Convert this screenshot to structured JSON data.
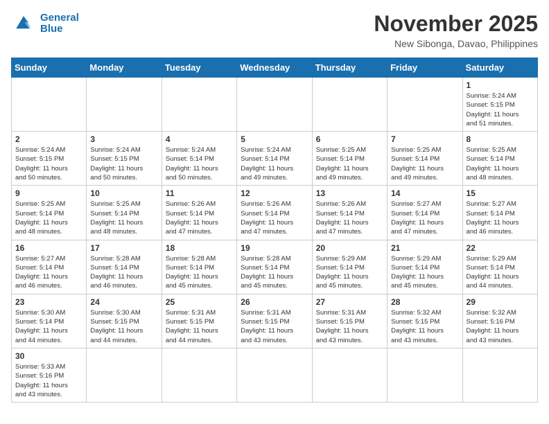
{
  "header": {
    "logo_line1": "General",
    "logo_line2": "Blue",
    "month": "November 2025",
    "location": "New Sibonga, Davao, Philippines"
  },
  "weekdays": [
    "Sunday",
    "Monday",
    "Tuesday",
    "Wednesday",
    "Thursday",
    "Friday",
    "Saturday"
  ],
  "weeks": [
    [
      {
        "day": "",
        "info": ""
      },
      {
        "day": "",
        "info": ""
      },
      {
        "day": "",
        "info": ""
      },
      {
        "day": "",
        "info": ""
      },
      {
        "day": "",
        "info": ""
      },
      {
        "day": "",
        "info": ""
      },
      {
        "day": "1",
        "info": "Sunrise: 5:24 AM\nSunset: 5:15 PM\nDaylight: 11 hours\nand 51 minutes."
      }
    ],
    [
      {
        "day": "2",
        "info": "Sunrise: 5:24 AM\nSunset: 5:15 PM\nDaylight: 11 hours\nand 50 minutes."
      },
      {
        "day": "3",
        "info": "Sunrise: 5:24 AM\nSunset: 5:15 PM\nDaylight: 11 hours\nand 50 minutes."
      },
      {
        "day": "4",
        "info": "Sunrise: 5:24 AM\nSunset: 5:14 PM\nDaylight: 11 hours\nand 50 minutes."
      },
      {
        "day": "5",
        "info": "Sunrise: 5:24 AM\nSunset: 5:14 PM\nDaylight: 11 hours\nand 49 minutes."
      },
      {
        "day": "6",
        "info": "Sunrise: 5:25 AM\nSunset: 5:14 PM\nDaylight: 11 hours\nand 49 minutes."
      },
      {
        "day": "7",
        "info": "Sunrise: 5:25 AM\nSunset: 5:14 PM\nDaylight: 11 hours\nand 49 minutes."
      },
      {
        "day": "8",
        "info": "Sunrise: 5:25 AM\nSunset: 5:14 PM\nDaylight: 11 hours\nand 48 minutes."
      }
    ],
    [
      {
        "day": "9",
        "info": "Sunrise: 5:25 AM\nSunset: 5:14 PM\nDaylight: 11 hours\nand 48 minutes."
      },
      {
        "day": "10",
        "info": "Sunrise: 5:25 AM\nSunset: 5:14 PM\nDaylight: 11 hours\nand 48 minutes."
      },
      {
        "day": "11",
        "info": "Sunrise: 5:26 AM\nSunset: 5:14 PM\nDaylight: 11 hours\nand 47 minutes."
      },
      {
        "day": "12",
        "info": "Sunrise: 5:26 AM\nSunset: 5:14 PM\nDaylight: 11 hours\nand 47 minutes."
      },
      {
        "day": "13",
        "info": "Sunrise: 5:26 AM\nSunset: 5:14 PM\nDaylight: 11 hours\nand 47 minutes."
      },
      {
        "day": "14",
        "info": "Sunrise: 5:27 AM\nSunset: 5:14 PM\nDaylight: 11 hours\nand 47 minutes."
      },
      {
        "day": "15",
        "info": "Sunrise: 5:27 AM\nSunset: 5:14 PM\nDaylight: 11 hours\nand 46 minutes."
      }
    ],
    [
      {
        "day": "16",
        "info": "Sunrise: 5:27 AM\nSunset: 5:14 PM\nDaylight: 11 hours\nand 46 minutes."
      },
      {
        "day": "17",
        "info": "Sunrise: 5:28 AM\nSunset: 5:14 PM\nDaylight: 11 hours\nand 46 minutes."
      },
      {
        "day": "18",
        "info": "Sunrise: 5:28 AM\nSunset: 5:14 PM\nDaylight: 11 hours\nand 45 minutes."
      },
      {
        "day": "19",
        "info": "Sunrise: 5:28 AM\nSunset: 5:14 PM\nDaylight: 11 hours\nand 45 minutes."
      },
      {
        "day": "20",
        "info": "Sunrise: 5:29 AM\nSunset: 5:14 PM\nDaylight: 11 hours\nand 45 minutes."
      },
      {
        "day": "21",
        "info": "Sunrise: 5:29 AM\nSunset: 5:14 PM\nDaylight: 11 hours\nand 45 minutes."
      },
      {
        "day": "22",
        "info": "Sunrise: 5:29 AM\nSunset: 5:14 PM\nDaylight: 11 hours\nand 44 minutes."
      }
    ],
    [
      {
        "day": "23",
        "info": "Sunrise: 5:30 AM\nSunset: 5:14 PM\nDaylight: 11 hours\nand 44 minutes."
      },
      {
        "day": "24",
        "info": "Sunrise: 5:30 AM\nSunset: 5:15 PM\nDaylight: 11 hours\nand 44 minutes."
      },
      {
        "day": "25",
        "info": "Sunrise: 5:31 AM\nSunset: 5:15 PM\nDaylight: 11 hours\nand 44 minutes."
      },
      {
        "day": "26",
        "info": "Sunrise: 5:31 AM\nSunset: 5:15 PM\nDaylight: 11 hours\nand 43 minutes."
      },
      {
        "day": "27",
        "info": "Sunrise: 5:31 AM\nSunset: 5:15 PM\nDaylight: 11 hours\nand 43 minutes."
      },
      {
        "day": "28",
        "info": "Sunrise: 5:32 AM\nSunset: 5:15 PM\nDaylight: 11 hours\nand 43 minutes."
      },
      {
        "day": "29",
        "info": "Sunrise: 5:32 AM\nSunset: 5:16 PM\nDaylight: 11 hours\nand 43 minutes."
      }
    ],
    [
      {
        "day": "30",
        "info": "Sunrise: 5:33 AM\nSunset: 5:16 PM\nDaylight: 11 hours\nand 43 minutes."
      },
      {
        "day": "",
        "info": ""
      },
      {
        "day": "",
        "info": ""
      },
      {
        "day": "",
        "info": ""
      },
      {
        "day": "",
        "info": ""
      },
      {
        "day": "",
        "info": ""
      },
      {
        "day": "",
        "info": ""
      }
    ]
  ]
}
